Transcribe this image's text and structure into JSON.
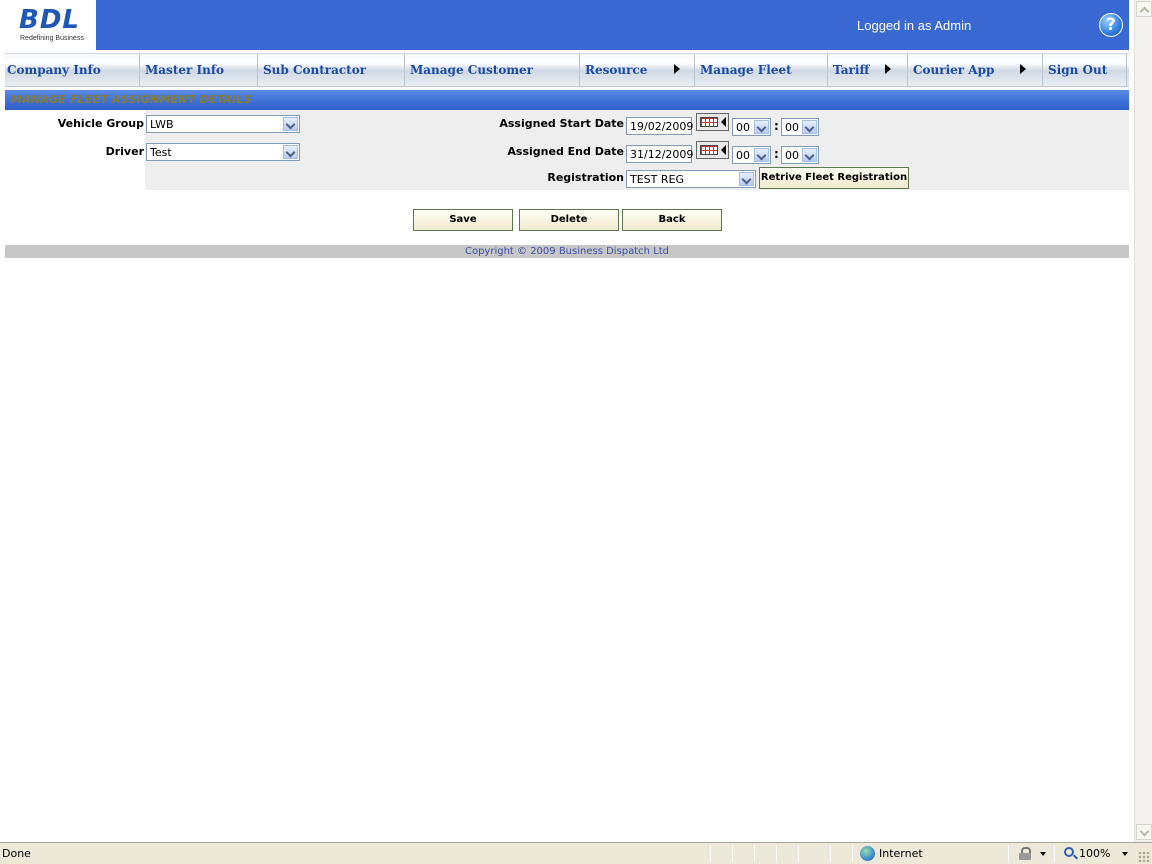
{
  "header": {
    "logo": "BDL",
    "tagline": "Redefining Business",
    "logged_in": "Logged in as Admin",
    "help_glyph": "?"
  },
  "nav": {
    "items": [
      {
        "label": "Company Info",
        "submenu": false
      },
      {
        "label": "Master Info",
        "submenu": false
      },
      {
        "label": "Sub Contractor",
        "submenu": false
      },
      {
        "label": "Manage Customer",
        "submenu": false
      },
      {
        "label": "Resource",
        "submenu": true
      },
      {
        "label": "Manage Fleet",
        "submenu": false
      },
      {
        "label": "Tariff",
        "submenu": true
      },
      {
        "label": "Courier App",
        "submenu": true
      },
      {
        "label": "Sign Out",
        "submenu": false
      }
    ]
  },
  "section": {
    "title": "MANAGE FLEET ASSIGNMENT DETAILS"
  },
  "form": {
    "vehicle_group_label": "Vehicle Group",
    "vehicle_group_value": "LWB",
    "driver_label": "Driver",
    "driver_value": "Test",
    "start_date_label": "Assigned Start Date",
    "start_date_value": "19/02/2009",
    "start_hour": "00",
    "start_minute": "00",
    "end_date_label": "Assigned End Date",
    "end_date_value": "31/12/2009",
    "end_hour": "00",
    "end_minute": "00",
    "time_separator": ":",
    "registration_label": "Registration",
    "registration_value": "TEST REG",
    "retrieve_button": "Retrive Fleet Registration"
  },
  "actions": {
    "save": "Save",
    "delete": "Delete",
    "back": "Back"
  },
  "footer": {
    "copyright": "Copyright © 2009 Business Dispatch Ltd"
  },
  "statusbar": {
    "status": "Done",
    "zone": "Internet",
    "zoom": "100%"
  }
}
